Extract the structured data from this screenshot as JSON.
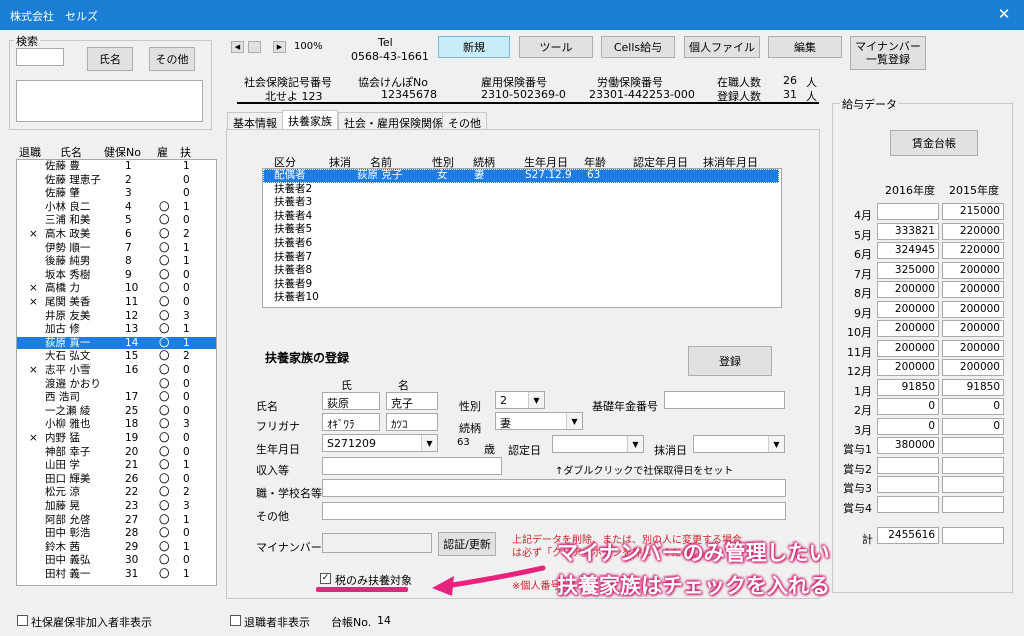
{
  "window": {
    "title": "株式会社　セルズ",
    "close": "✕"
  },
  "search": {
    "group_label": "検索",
    "name_button": "氏名",
    "other_button": "その他",
    "input_value": ""
  },
  "employee_list": {
    "headers": [
      "退職",
      "氏名",
      "健保No",
      "雇",
      "扶"
    ],
    "rows": [
      {
        "ret": "",
        "name": "佐藤 豊",
        "no": "1",
        "koyo": "",
        "fu": "1"
      },
      {
        "ret": "",
        "name": "佐藤 理恵子",
        "no": "2",
        "koyo": "",
        "fu": "0"
      },
      {
        "ret": "",
        "name": "佐藤 肇",
        "no": "3",
        "koyo": "",
        "fu": "0"
      },
      {
        "ret": "",
        "name": "小林 良二",
        "no": "4",
        "koyo": "〇",
        "fu": "1"
      },
      {
        "ret": "",
        "name": "三浦 和美",
        "no": "5",
        "koyo": "〇",
        "fu": "0"
      },
      {
        "ret": "×",
        "name": "高木 政美",
        "no": "6",
        "koyo": "〇",
        "fu": "2"
      },
      {
        "ret": "",
        "name": "伊勢 順一",
        "no": "7",
        "koyo": "〇",
        "fu": "1"
      },
      {
        "ret": "",
        "name": "後藤 純男",
        "no": "8",
        "koyo": "〇",
        "fu": "1"
      },
      {
        "ret": "",
        "name": "坂本 秀樹",
        "no": "9",
        "koyo": "〇",
        "fu": "0"
      },
      {
        "ret": "×",
        "name": "高橋 力",
        "no": "10",
        "koyo": "〇",
        "fu": "0"
      },
      {
        "ret": "×",
        "name": "尾関 美香",
        "no": "11",
        "koyo": "〇",
        "fu": "0"
      },
      {
        "ret": "",
        "name": "井原 友美",
        "no": "12",
        "koyo": "〇",
        "fu": "3"
      },
      {
        "ret": "",
        "name": "加古 修",
        "no": "13",
        "koyo": "〇",
        "fu": "1"
      },
      {
        "ret": "",
        "name": "荻原 真一",
        "no": "14",
        "koyo": "〇",
        "fu": "1"
      },
      {
        "ret": "",
        "name": "大石 弘文",
        "no": "15",
        "koyo": "〇",
        "fu": "2"
      },
      {
        "ret": "×",
        "name": "志平 小雪",
        "no": "16",
        "koyo": "〇",
        "fu": "0"
      },
      {
        "ret": "",
        "name": "渡邉 かおり",
        "no": "",
        "koyo": "〇",
        "fu": "0"
      },
      {
        "ret": "",
        "name": "西 浩司",
        "no": "17",
        "koyo": "〇",
        "fu": "0"
      },
      {
        "ret": "",
        "name": "一之瀬 綾",
        "no": "25",
        "koyo": "〇",
        "fu": "0"
      },
      {
        "ret": "",
        "name": "小柳 雅也",
        "no": "18",
        "koyo": "〇",
        "fu": "3"
      },
      {
        "ret": "×",
        "name": "内野 猛",
        "no": "19",
        "koyo": "〇",
        "fu": "0"
      },
      {
        "ret": "",
        "name": "神部 幸子",
        "no": "20",
        "koyo": "〇",
        "fu": "0"
      },
      {
        "ret": "",
        "name": "山田 学",
        "no": "21",
        "koyo": "〇",
        "fu": "1"
      },
      {
        "ret": "",
        "name": "田口 輝美",
        "no": "26",
        "koyo": "〇",
        "fu": "0"
      },
      {
        "ret": "",
        "name": "松元 涼",
        "no": "22",
        "koyo": "〇",
        "fu": "2"
      },
      {
        "ret": "",
        "name": "加藤 晃",
        "no": "23",
        "koyo": "〇",
        "fu": "3"
      },
      {
        "ret": "",
        "name": "阿部 允啓",
        "no": "27",
        "koyo": "〇",
        "fu": "1"
      },
      {
        "ret": "",
        "name": "田中 彰浩",
        "no": "28",
        "koyo": "〇",
        "fu": "0"
      },
      {
        "ret": "",
        "name": "鈴木 茜",
        "no": "29",
        "koyo": "〇",
        "fu": "1"
      },
      {
        "ret": "",
        "name": "田中 義弘",
        "no": "30",
        "koyo": "〇",
        "fu": "0"
      },
      {
        "ret": "",
        "name": "田村 義一",
        "no": "31",
        "koyo": "〇",
        "fu": "1"
      }
    ],
    "selected_index": 13
  },
  "bottom": {
    "shaho_hide": "社保雇保非加入者非表示",
    "retired_hide": "退職者非表示",
    "ledger_no_label": "台帳No.",
    "ledger_no_value": "14"
  },
  "toolbar": {
    "zoom": "100%",
    "tel_label": "Tel",
    "tel_value": "0568-43-1661",
    "new": "新規",
    "tool": "ツール",
    "cells_salary": "Cells給与",
    "personal_file": "個人ファイル",
    "edit": "編集",
    "mynumber_list_1": "マイナンバー",
    "mynumber_list_2": "一覧登録"
  },
  "info": {
    "shaho_label": "社会保険記号番号",
    "shaho_value": "北せよ 123",
    "kyokai_label": "協会けんぽNo",
    "kyokai_value": "12345678",
    "koyo_label": "雇用保険番号",
    "koyo_value": "2310-502369-0",
    "rodo_label": "労働保険番号",
    "rodo_value": "23301-442253-000",
    "zaishoku_label": "在職人数",
    "zaishoku_value": "26",
    "touroku_label": "登録人数",
    "touroku_value": "31",
    "unit": "人"
  },
  "tabs": [
    "基本情報",
    "扶養家族",
    "社会・雇用保険関係",
    "その他"
  ],
  "dependents": {
    "headers": [
      "区分",
      "抹消",
      "名前",
      "性別",
      "続柄",
      "生年月日",
      "年齢",
      "認定年月日",
      "抹消年月日"
    ],
    "rows": [
      {
        "kubun": "配偶者",
        "name": "荻原 克子",
        "sex": "女",
        "rel": "妻",
        "birth": "S27.12.9",
        "age": "63"
      },
      {
        "kubun": "扶養者2"
      },
      {
        "kubun": "扶養者3"
      },
      {
        "kubun": "扶養者4"
      },
      {
        "kubun": "扶養者5"
      },
      {
        "kubun": "扶養者6"
      },
      {
        "kubun": "扶養者7"
      },
      {
        "kubun": "扶養者8"
      },
      {
        "kubun": "扶養者9"
      },
      {
        "kubun": "扶養者10"
      }
    ]
  },
  "form": {
    "title": "扶養家族の登録",
    "register": "登録",
    "sei_header": "氏",
    "mei_header": "名",
    "name_label": "氏名",
    "sei": "荻原",
    "mei": "克子",
    "sex_label": "性別",
    "sex_value": "2",
    "kiso_label": "基礎年金番号",
    "furigana_label": "フリガナ",
    "furi_sei": "ｵｷﾞﾜﾗ",
    "furi_mei": "ｶﾂｺ",
    "rel_label": "続柄",
    "rel_value": "妻",
    "birth_label": "生年月日",
    "birth_value": "S271209",
    "age_value": "63",
    "age_unit": "歳",
    "nintei_label": "認定日",
    "masho_label": "抹消日",
    "income_label": "収入等",
    "dblclick_hint": "↑ダブルクリックで社保取得日をセット",
    "job_label": "職・学校名等",
    "other_label": "その他",
    "mynumber_label": "マイナンバー",
    "auth_button": "認証/更新",
    "warn_1": "上記データを削除、または、別の人に変更する場合",
    "warn_2": "は必ず「クリア」ボタンを押してください。",
    "tax_only": "税のみ扶養対象",
    "note": "※個人番号"
  },
  "callout": {
    "line1": "マイナンバーのみ管理したい",
    "line2": "扶養家族はチェックを入れる"
  },
  "salary": {
    "group_label": "給与データ",
    "ledger_button": "賃金台帳",
    "year1": "2016年度",
    "year2": "2015年度",
    "rows": [
      {
        "m": "4月",
        "a": "",
        "b": "215000"
      },
      {
        "m": "5月",
        "a": "333821",
        "b": "220000"
      },
      {
        "m": "6月",
        "a": "324945",
        "b": "220000"
      },
      {
        "m": "7月",
        "a": "325000",
        "b": "200000"
      },
      {
        "m": "8月",
        "a": "200000",
        "b": "200000"
      },
      {
        "m": "9月",
        "a": "200000",
        "b": "200000"
      },
      {
        "m": "10月",
        "a": "200000",
        "b": "200000"
      },
      {
        "m": "11月",
        "a": "200000",
        "b": "200000"
      },
      {
        "m": "12月",
        "a": "200000",
        "b": "200000"
      },
      {
        "m": "1月",
        "a": "91850",
        "b": "91850"
      },
      {
        "m": "2月",
        "a": "0",
        "b": "0"
      },
      {
        "m": "3月",
        "a": "0",
        "b": "0"
      },
      {
        "m": "賞与1",
        "a": "380000",
        "b": ""
      },
      {
        "m": "賞与2",
        "a": "",
        "b": ""
      },
      {
        "m": "賞与3",
        "a": "",
        "b": ""
      },
      {
        "m": "賞与4",
        "a": "",
        "b": ""
      }
    ],
    "total_label": "計",
    "total_a": "2455616",
    "total_b": ""
  },
  "colors": {
    "titlebar": "#1a7fd4",
    "selection": "#1f7ce0",
    "callout": "#d6277a"
  }
}
